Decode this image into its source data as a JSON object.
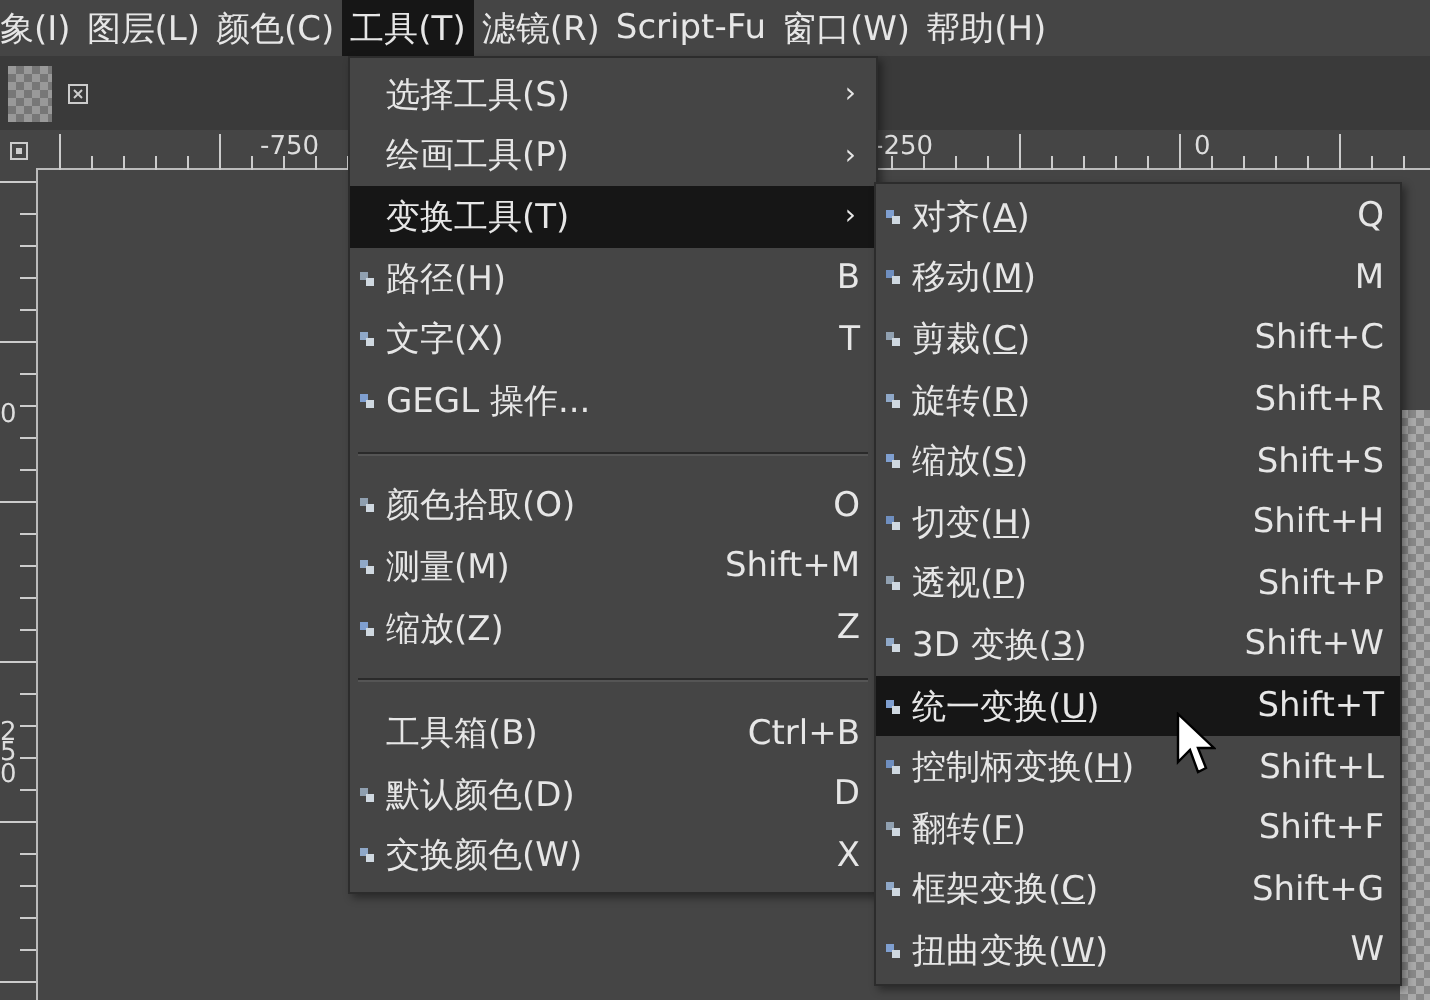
{
  "menubar": [
    {
      "label": "象(I)",
      "selected": false
    },
    {
      "label": "图层(L)",
      "selected": false
    },
    {
      "label": "颜色(C)",
      "selected": false
    },
    {
      "label": "工具(T)",
      "selected": true
    },
    {
      "label": "滤镜(R)",
      "selected": false
    },
    {
      "label": "Script-Fu",
      "selected": false
    },
    {
      "label": "窗口(W)",
      "selected": false
    },
    {
      "label": "帮助(H)",
      "selected": false
    }
  ],
  "rulers": {
    "top_labels": [
      "-750",
      "-250",
      "0"
    ],
    "left_labels": [
      "0",
      "250"
    ]
  },
  "tools_menu": {
    "sections": [
      [
        {
          "kind": "submenu",
          "label": "选择工具(S)",
          "arrow": "›",
          "selected": false
        },
        {
          "kind": "submenu",
          "label": "绘画工具(P)",
          "arrow": "›",
          "selected": false
        },
        {
          "kind": "submenu",
          "label": "变换工具(T)",
          "arrow": "›",
          "selected": true
        },
        {
          "kind": "tool",
          "label": "路径(H)",
          "shortcut": "B",
          "selected": false
        },
        {
          "kind": "tool",
          "label": "文字(X)",
          "shortcut": "T",
          "selected": false
        },
        {
          "kind": "tool",
          "label": "GEGL 操作...",
          "selected": false
        }
      ],
      [
        {
          "kind": "tool",
          "label": "颜色拾取(O)",
          "shortcut": "O",
          "selected": false
        },
        {
          "kind": "tool",
          "label": "测量(M)",
          "shortcut": "Shift+M",
          "selected": false
        },
        {
          "kind": "tool",
          "label": "缩放(Z)",
          "shortcut": "Z",
          "selected": false
        }
      ],
      [
        {
          "kind": "plain",
          "label": "工具箱(B)",
          "shortcut": "Ctrl+B",
          "selected": false
        },
        {
          "kind": "tool",
          "label": "默认颜色(D)",
          "shortcut": "D",
          "selected": false
        },
        {
          "kind": "tool",
          "label": "交换颜色(W)",
          "shortcut": "X",
          "selected": false
        }
      ]
    ]
  },
  "transform_menu": {
    "items": [
      {
        "before": "对齐(",
        "mnemonic": "A",
        "after": ")",
        "shortcut": "Q",
        "selected": false
      },
      {
        "before": "移动(",
        "mnemonic": "M",
        "after": ")",
        "shortcut": "M",
        "selected": false
      },
      {
        "before": "剪裁(",
        "mnemonic": "C",
        "after": ")",
        "shortcut": "Shift+C",
        "selected": false
      },
      {
        "before": "旋转(",
        "mnemonic": "R",
        "after": ")",
        "shortcut": "Shift+R",
        "selected": false
      },
      {
        "before": "缩放(",
        "mnemonic": "S",
        "after": ")",
        "shortcut": "Shift+S",
        "selected": false
      },
      {
        "before": "切变(",
        "mnemonic": "H",
        "after": ")",
        "shortcut": "Shift+H",
        "selected": false
      },
      {
        "before": "透视(",
        "mnemonic": "P",
        "after": ")",
        "shortcut": "Shift+P",
        "selected": false
      },
      {
        "before": "3D 变换(",
        "mnemonic": "3",
        "after": ")",
        "shortcut": "Shift+W",
        "selected": false
      },
      {
        "before": "统一变换(",
        "mnemonic": "U",
        "after": ")",
        "shortcut": "Shift+T",
        "selected": true
      },
      {
        "before": "控制柄变换(",
        "mnemonic": "H",
        "after": ")",
        "shortcut": "Shift+L",
        "selected": false
      },
      {
        "before": "翻转(",
        "mnemonic": "F",
        "after": ")",
        "shortcut": "Shift+F",
        "selected": false
      },
      {
        "before": "框架变换(",
        "mnemonic": "C",
        "after": ")",
        "shortcut": "Shift+G",
        "selected": false
      },
      {
        "before": "扭曲变换(",
        "mnemonic": "W",
        "after": ")",
        "shortcut": "W",
        "selected": false
      }
    ]
  }
}
